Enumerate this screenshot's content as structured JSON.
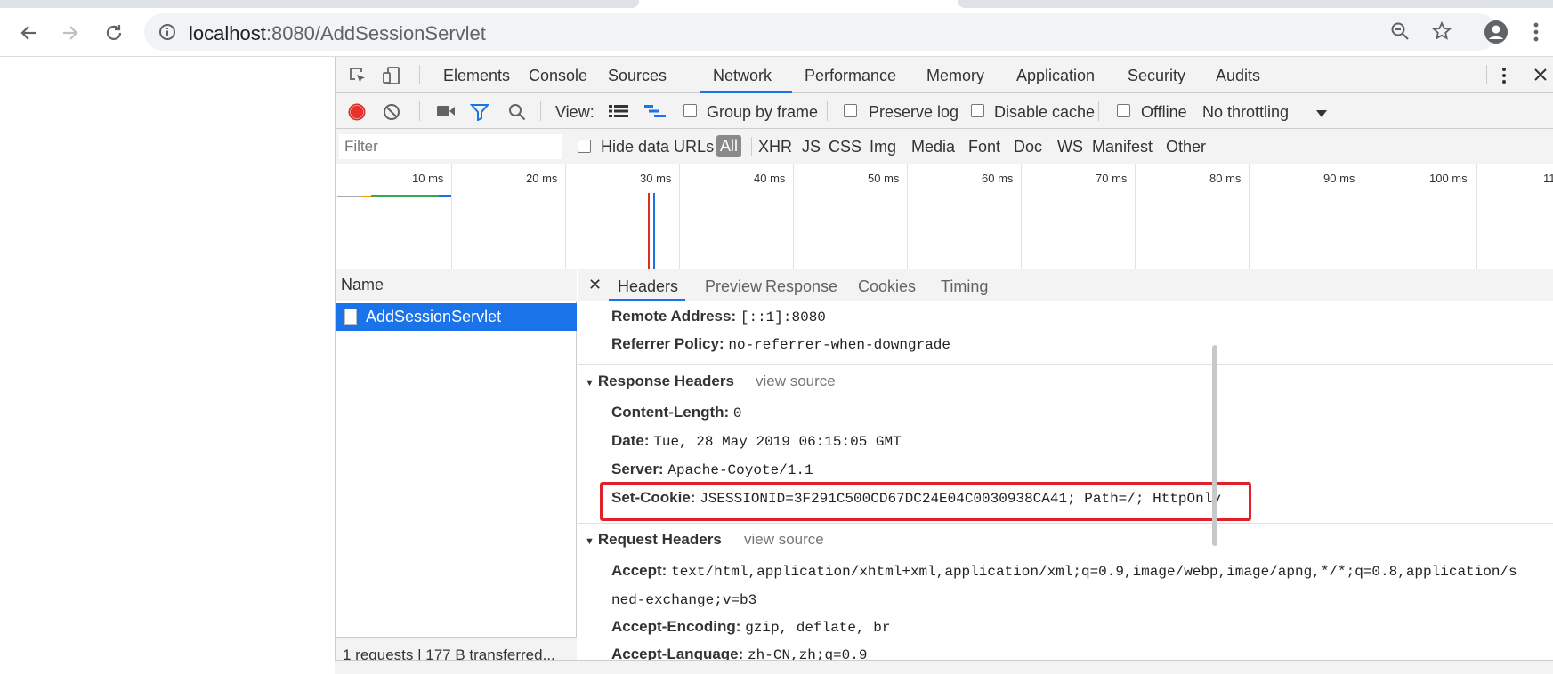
{
  "browser": {
    "url_host": "localhost",
    "url_rest": ":8080/AddSessionServlet"
  },
  "devtools": {
    "tabs": [
      "Elements",
      "Console",
      "Sources",
      "Network",
      "Performance",
      "Memory",
      "Application",
      "Security",
      "Audits"
    ],
    "active_tab": "Network",
    "network_toolbar": {
      "view_label": "View:",
      "group_by_frame": "Group by frame",
      "preserve_log": "Preserve log",
      "disable_cache": "Disable cache",
      "offline": "Offline",
      "throttling": "No throttling"
    },
    "filter_bar": {
      "placeholder": "Filter",
      "hide_data_urls": "Hide data URLs",
      "types": [
        "All",
        "XHR",
        "JS",
        "CSS",
        "Img",
        "Media",
        "Font",
        "Doc",
        "WS",
        "Manifest",
        "Other"
      ]
    },
    "overview_ticks": [
      "10 ms",
      "20 ms",
      "30 ms",
      "40 ms",
      "50 ms",
      "60 ms",
      "70 ms",
      "80 ms",
      "90 ms",
      "100 ms",
      "11"
    ],
    "request_list": {
      "header": "Name",
      "requests": [
        "AddSessionServlet"
      ],
      "footer": "1 requests | 177 B transferred..."
    },
    "detail_tabs": [
      "Headers",
      "Preview",
      "Response",
      "Cookies",
      "Timing"
    ],
    "general": {
      "remote_address_key": "Remote Address:",
      "remote_address_val": "[::1]:8080",
      "referrer_policy_key": "Referrer Policy:",
      "referrer_policy_val": "no-referrer-when-downgrade"
    },
    "response_headers": {
      "title": "Response Headers",
      "view_source": "view source",
      "items": [
        {
          "k": "Content-Length:",
          "v": "0"
        },
        {
          "k": "Date:",
          "v": "Tue, 28 May 2019 06:15:05 GMT"
        },
        {
          "k": "Server:",
          "v": "Apache-Coyote/1.1"
        },
        {
          "k": "Set-Cookie:",
          "v": "JSESSIONID=3F291C500CD67DC24E04C0030938CA41; Path=/; HttpOnly"
        }
      ]
    },
    "request_headers": {
      "title": "Request Headers",
      "view_source": "view source",
      "accept_key": "Accept:",
      "accept_val1": "text/html,application/xhtml+xml,application/xml;q=0.9,image/webp,image/apng,*/*;q=0.8,application/s",
      "accept_val2": "ned-exchange;v=b3",
      "accept_encoding_key": "Accept-Encoding:",
      "accept_encoding_val": "gzip, deflate, br",
      "accept_language_key": "Accept-Language:",
      "accept_language_val": "zh-CN,zh;q=0.9"
    }
  }
}
